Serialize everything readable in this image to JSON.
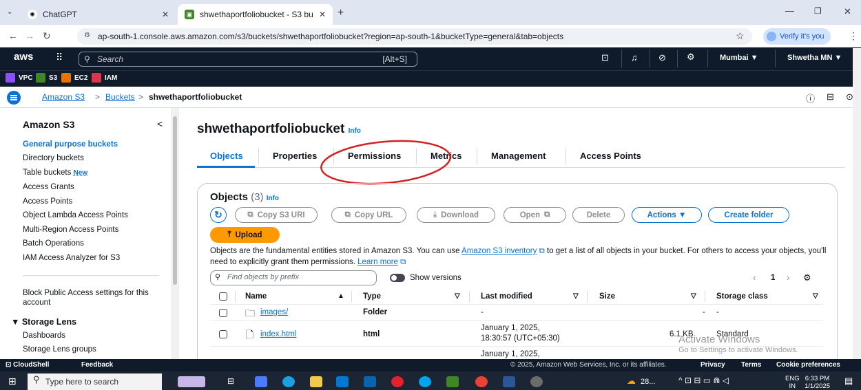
{
  "browser": {
    "tabs": [
      {
        "title": "ChatGPT"
      },
      {
        "title": "shwethaportfoliobucket - S3 bu"
      }
    ],
    "new_tab": "+",
    "url": "ap-south-1.console.aws.amazon.com/s3/buckets/shwethaportfoliobucket?region=ap-south-1&bucketType=general&tab=objects",
    "verify": "Verify it's you"
  },
  "aws_nav": {
    "logo": "aws",
    "search_placeholder": "Search",
    "search_shortcut": "[Alt+S]",
    "region": "Mumbai ▼",
    "user": "Shwetha MN ▼"
  },
  "favorites": [
    {
      "label": "VPC",
      "color": "#8c4fff"
    },
    {
      "label": "S3",
      "color": "#3f8624"
    },
    {
      "label": "EC2",
      "color": "#ed7100"
    },
    {
      "label": "IAM",
      "color": "#dd344c"
    }
  ],
  "breadcrumb": {
    "root": "Amazon S3",
    "sep": ">",
    "level2": "Buckets",
    "current": "shwethaportfoliobucket"
  },
  "sidebar": {
    "title": "Amazon S3",
    "collapse": "<",
    "items": [
      {
        "label": "General purpose buckets",
        "active": true
      },
      {
        "label": "Directory buckets"
      },
      {
        "label": "Table buckets",
        "badge": "New"
      },
      {
        "label": "Access Grants"
      },
      {
        "label": "Access Points"
      },
      {
        "label": "Object Lambda Access Points"
      },
      {
        "label": "Multi-Region Access Points"
      },
      {
        "label": "Batch Operations"
      },
      {
        "label": "IAM Access Analyzer for S3"
      }
    ],
    "block_public": "Block Public Access settings for this account",
    "storage_lens": "▼ Storage Lens",
    "storage_items": [
      "Dashboards",
      "Storage Lens groups"
    ]
  },
  "main": {
    "bucket_name": "shwethaportfoliobucket",
    "info": "Info",
    "tabs": [
      "Objects",
      "Properties",
      "Permissions",
      "Metrics",
      "Management",
      "Access Points"
    ],
    "objects_title": "Objects",
    "objects_count": "(3)",
    "buttons": {
      "copy_uri": "Copy S3 URI",
      "copy_url": "Copy URL",
      "download": "Download",
      "open": "Open",
      "delete": "Delete",
      "actions": "Actions ▼",
      "create_folder": "Create folder",
      "upload": "Upload"
    },
    "description_1": "Objects are the fundamental entities stored in Amazon S3. You can use ",
    "inventory_link": "Amazon S3 inventory",
    "description_2": " to get a list of all objects in your bucket. For others to access your objects, you'll need to explicitly grant them permissions. ",
    "learn_more": "Learn more",
    "find_placeholder": "Find objects by prefix",
    "show_versions": "Show versions",
    "page": "1",
    "columns": [
      "Name",
      "Type",
      "Last modified",
      "Size",
      "Storage class"
    ],
    "rows": [
      {
        "name": "images/",
        "type": "Folder",
        "modified": "-",
        "size": "-",
        "storage": "-"
      },
      {
        "name": "index.html",
        "type": "html",
        "modified_1": "January 1, 2025,",
        "modified_2": "18:30:57 (UTC+05:30)",
        "size": "6.1 KB",
        "storage": "Standard"
      },
      {
        "modified_1": "January 1, 2025,"
      }
    ]
  },
  "watermark": {
    "line1": "Activate Windows",
    "line2": "Go to Settings to activate Windows."
  },
  "footer": {
    "cloudshell": "CloudShell",
    "feedback": "Feedback",
    "copyright": "© 2025, Amazon Web Services, Inc. or its affiliates.",
    "privacy": "Privacy",
    "terms": "Terms",
    "cookies": "Cookie preferences"
  },
  "taskbar": {
    "search": "Type here to search",
    "weather": "28...",
    "lang_1": "ENG",
    "lang_2": "IN",
    "time": "6:33 PM",
    "date": "1/1/2025"
  }
}
